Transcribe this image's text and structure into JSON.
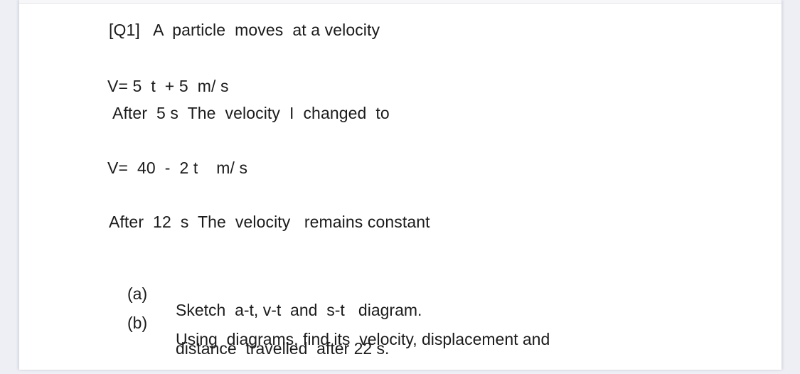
{
  "document": {
    "question_label": "[Q1]",
    "intro": "A  particle  moves  at a velocity",
    "heading_line": "[Q1]   A  particle  moves  at a velocity",
    "equation_1": "V= 5  t  + 5  m/ s",
    "condition_1": "After  5 s  The  velocity  I  changed  to",
    "equation_2": "V=  40  -  2 t    m/ s",
    "condition_2": "After  12  s  The  velocity   remains constant",
    "items": [
      {
        "marker": "(a)",
        "text": "Sketch  a-t, v-t  and  s-t   diagram.",
        "continuation": ""
      },
      {
        "marker": "(b)",
        "text": "Using  diagrams, find its  velocity, displacement and",
        "continuation": "distance  travelled  after 22 s."
      }
    ],
    "colors": {
      "text": "#1b1b1b",
      "page_background": "#ffffff",
      "margin_background": "#eeeff5"
    }
  }
}
